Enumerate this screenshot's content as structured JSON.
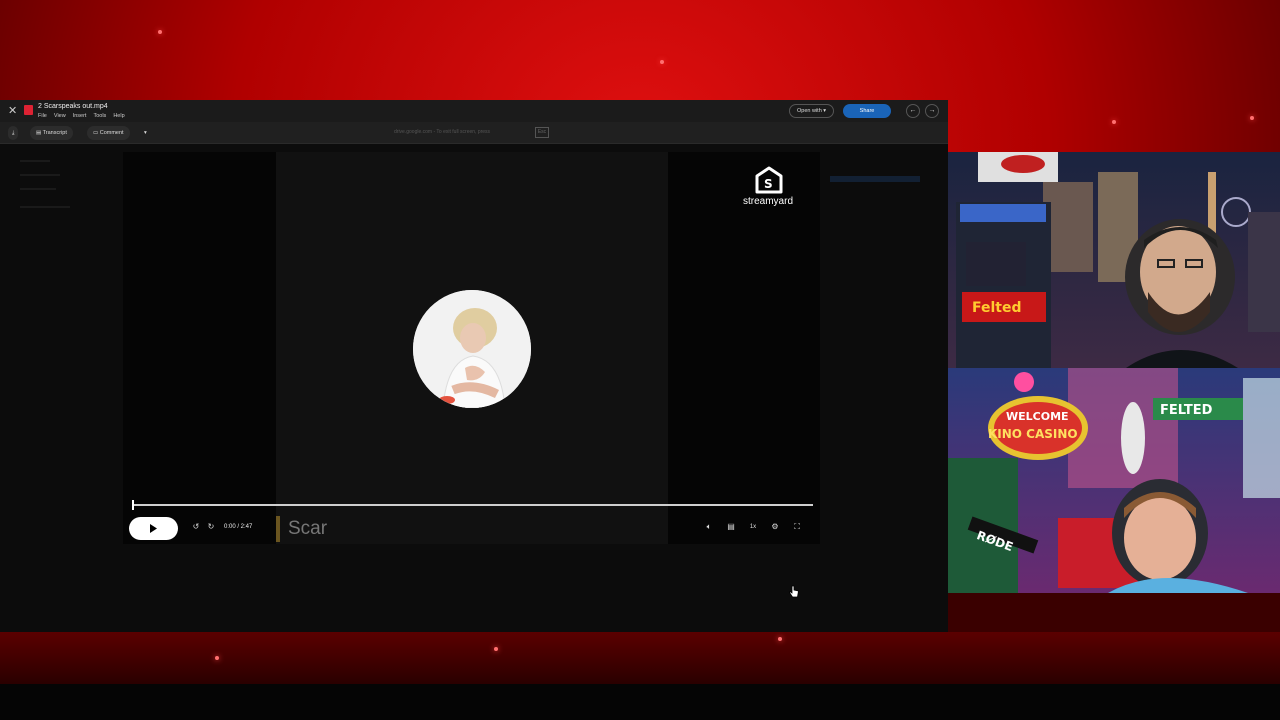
{
  "window": {
    "doc_title": "2 Scarspeaks out.mp4",
    "menu": [
      "File",
      "View",
      "Insert",
      "Tools",
      "Help"
    ],
    "open_with_label": "Open with",
    "share_label": "Share"
  },
  "toolbar": {
    "transcript_label": "Transcript",
    "comment_label": "Comment",
    "url_hint": "drive.google.com - To exit full screen, press",
    "esc_label": "Esc"
  },
  "video": {
    "watermark": "streamyard",
    "time_readout": "0:00 / 2:47",
    "progress_fraction": 0.0,
    "caption": "Scar"
  },
  "colors": {
    "share_blue": "#1a64b8",
    "stage_red": "#b00000"
  }
}
